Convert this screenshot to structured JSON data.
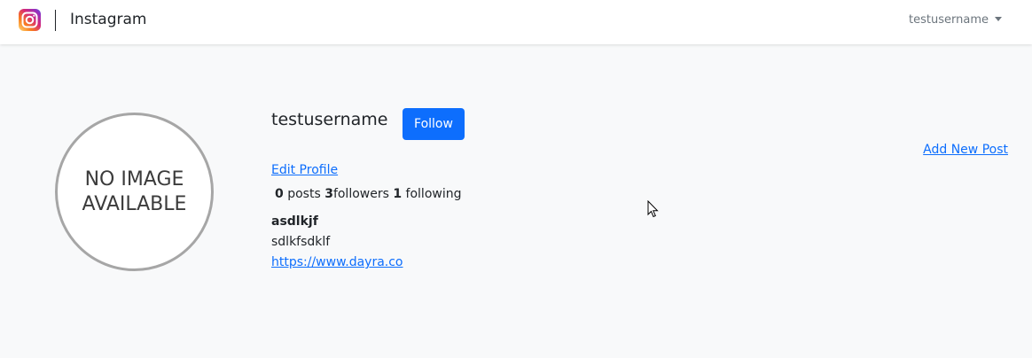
{
  "nav": {
    "brand": "Instagram",
    "logo_icon": "instagram-logo-icon",
    "user_menu_label": "testusername"
  },
  "profile": {
    "avatar_placeholder_line1": "NO IMAGE",
    "avatar_placeholder_line2": "AVAILABLE",
    "username": "testusername",
    "follow_label": "Follow",
    "edit_profile_label": "Edit Profile",
    "add_post_label": "Add New Post",
    "posts_count": "0",
    "posts_label": "posts",
    "followers_count": "3",
    "followers_label": "followers",
    "following_count": "1",
    "following_label": "following",
    "full_name": "asdlkjf",
    "bio": "sdlkfsdklf",
    "website": "https://www.dayra.co"
  },
  "colors": {
    "primary": "#0d6efd",
    "background": "#f8f9fa",
    "navbar": "#ffffff",
    "muted": "#6c757d"
  }
}
